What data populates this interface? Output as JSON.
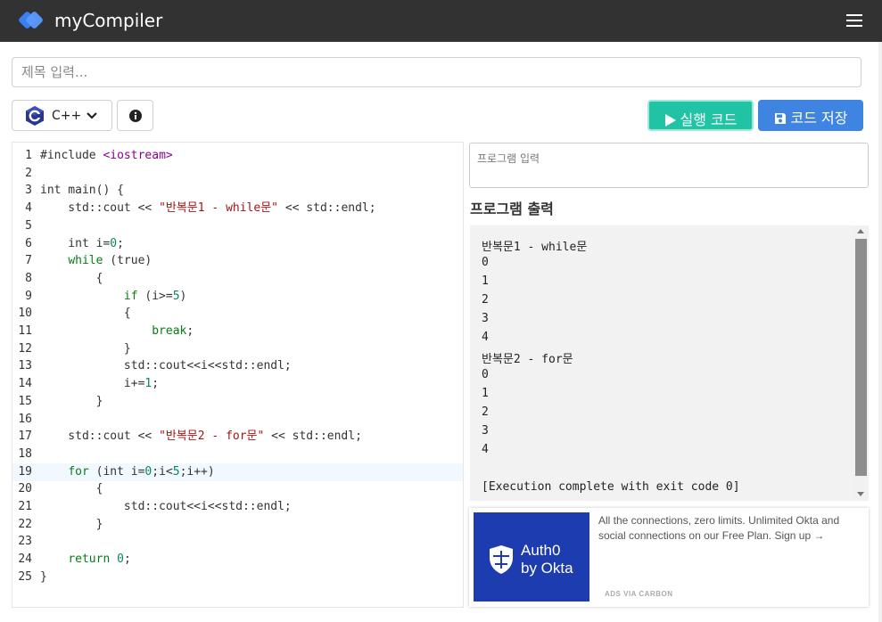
{
  "navbar": {
    "brand": "myCompiler",
    "brand_color": "#3b7ff5"
  },
  "title_input": {
    "placeholder": "제목 입력..."
  },
  "toolbar": {
    "language": "C++",
    "run_label": "실행 코드",
    "save_label": "코드 저장",
    "run_color": "#20c4a5",
    "save_color": "#3e84e0"
  },
  "editor": {
    "active_line": 19,
    "lines": [
      [
        [
          "#include ",
          ""
        ],
        [
          "<iostream>",
          "inc"
        ]
      ],
      [],
      [
        [
          "int main() {",
          ""
        ]
      ],
      [
        [
          "    std::cout << ",
          ""
        ],
        [
          "\"반복문1 - while문\"",
          "str"
        ],
        [
          " << std::endl;",
          ""
        ]
      ],
      [],
      [
        [
          "    int i=",
          ""
        ],
        [
          "0",
          "num"
        ],
        [
          ";",
          ""
        ]
      ],
      [
        [
          "    ",
          ""
        ],
        [
          "while",
          "kw"
        ],
        [
          " (true)",
          ""
        ]
      ],
      [
        [
          "        {",
          ""
        ]
      ],
      [
        [
          "            ",
          ""
        ],
        [
          "if",
          "kw"
        ],
        [
          " (i>=",
          ""
        ],
        [
          "5",
          "num"
        ],
        [
          ")",
          ""
        ]
      ],
      [
        [
          "            {",
          ""
        ]
      ],
      [
        [
          "                ",
          ""
        ],
        [
          "break",
          "kw"
        ],
        [
          ";",
          ""
        ]
      ],
      [
        [
          "            }",
          ""
        ]
      ],
      [
        [
          "            std::cout<<i<<std::endl;",
          ""
        ]
      ],
      [
        [
          "            i+=",
          ""
        ],
        [
          "1",
          "num"
        ],
        [
          ";",
          ""
        ]
      ],
      [
        [
          "        }",
          ""
        ]
      ],
      [],
      [
        [
          "    std::cout << ",
          ""
        ],
        [
          "\"반복문2 - for문\"",
          "str"
        ],
        [
          " << std::endl;",
          ""
        ]
      ],
      [],
      [
        [
          "    ",
          ""
        ],
        [
          "for",
          "kw"
        ],
        [
          " (int i=",
          ""
        ],
        [
          "0",
          "num"
        ],
        [
          ";i<",
          ""
        ],
        [
          "5",
          "num"
        ],
        [
          ";i++)",
          ""
        ]
      ],
      [
        [
          "        {",
          ""
        ]
      ],
      [
        [
          "            std::cout<<i<<std::endl;",
          ""
        ]
      ],
      [
        [
          "        }",
          ""
        ]
      ],
      [],
      [
        [
          "    ",
          ""
        ],
        [
          "return",
          "kw"
        ],
        [
          " ",
          ""
        ],
        [
          "0",
          "num"
        ],
        [
          ";",
          ""
        ]
      ],
      [
        [
          "}",
          ""
        ]
      ]
    ]
  },
  "program_input": {
    "placeholder": "프로그램 입력"
  },
  "output": {
    "heading": "프로그램 출력",
    "lines": [
      "반복문1 - while문",
      "0",
      "1",
      "2",
      "3",
      "4",
      "반복문2 - for문",
      "0",
      "1",
      "2",
      "3",
      "4",
      "",
      "[Execution complete with exit code 0]"
    ]
  },
  "ad": {
    "logo_line1": "Auth0",
    "logo_line2": "by Okta",
    "text": "All the connections, zero limits. Unlimited Okta and social connections on our Free Plan. Sign up →",
    "via": "ADS VIA CARBON",
    "bg_color": "#1d3cb0"
  }
}
